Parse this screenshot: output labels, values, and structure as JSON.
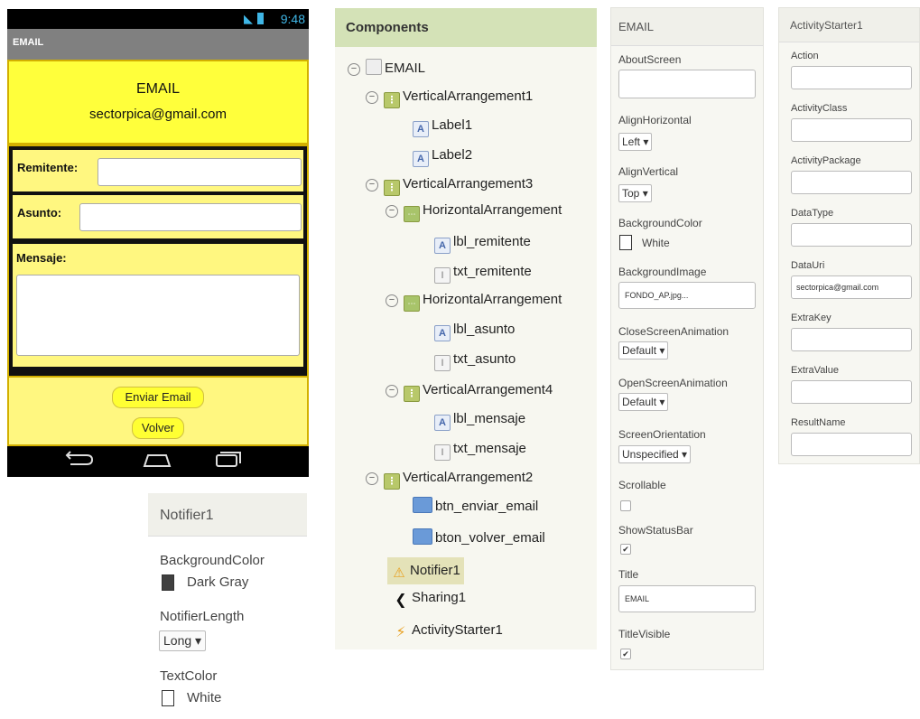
{
  "phone": {
    "status_time": "9:48",
    "title": "EMAIL",
    "header_title": "EMAIL",
    "header_email": "sectorpica@gmail.com",
    "remitente_label": "Remitente:",
    "asunto_label": "Asunto:",
    "mensaje_label": "Mensaje:",
    "send_button": "Enviar Email",
    "back_button": "Volver"
  },
  "notifier": {
    "title": "Notifier1",
    "props": [
      {
        "label": "BackgroundColor",
        "value": "Dark Gray"
      },
      {
        "label": "NotifierLength",
        "value": "Long"
      },
      {
        "label": "TextColor",
        "value": "White"
      }
    ]
  },
  "components": {
    "title": "Components",
    "tree": [
      {
        "label": "EMAIL",
        "icon": "screen-icon"
      },
      {
        "label": "VerticalArrangement1",
        "icon": "vertical-arrangement-icon"
      },
      {
        "label": "Label1",
        "icon": "label-icon"
      },
      {
        "label": "Label2",
        "icon": "label-icon"
      },
      {
        "label": "VerticalArrangement3",
        "icon": "vertical-arrangement-icon"
      },
      {
        "label": "HorizontalArrangement",
        "icon": "horizontal-arrangement-icon"
      },
      {
        "label": "lbl_remitente",
        "icon": "label-icon"
      },
      {
        "label": "txt_remitente",
        "icon": "textbox-icon"
      },
      {
        "label": "HorizontalArrangement",
        "icon": "horizontal-arrangement-icon"
      },
      {
        "label": "lbl_asunto",
        "icon": "label-icon"
      },
      {
        "label": "txt_asunto",
        "icon": "textbox-icon"
      },
      {
        "label": "VerticalArrangement4",
        "icon": "vertical-arrangement-icon"
      },
      {
        "label": "lbl_mensaje",
        "icon": "label-icon"
      },
      {
        "label": "txt_mensaje",
        "icon": "textbox-icon"
      },
      {
        "label": "VerticalArrangement2",
        "icon": "vertical-arrangement-icon"
      },
      {
        "label": "btn_enviar_email",
        "icon": "button-icon"
      },
      {
        "label": "bton_volver_email",
        "icon": "button-icon"
      },
      {
        "label": "Notifier1",
        "icon": "warning-icon"
      },
      {
        "label": "Sharing1",
        "icon": "share-icon"
      },
      {
        "label": "ActivityStarter1",
        "icon": "lightning-icon"
      }
    ]
  },
  "email_props": {
    "title": "EMAIL",
    "about_screen": "AboutScreen",
    "align_horizontal": "AlignHorizontal",
    "align_horizontal_value": "Left",
    "align_vertical": "AlignVertical",
    "align_vertical_value": "Top",
    "background_color": "BackgroundColor",
    "background_color_value": "White",
    "background_image": "BackgroundImage",
    "background_image_value": "FONDO_AP.jpg...",
    "close_anim": "CloseScreenAnimation",
    "close_anim_value": "Default",
    "open_anim": "OpenScreenAnimation",
    "open_anim_value": "Default",
    "orientation": "ScreenOrientation",
    "orientation_value": "Unspecified",
    "scrollable": "Scrollable",
    "show_status_bar": "ShowStatusBar",
    "title_label": "Title",
    "title_value": "EMAIL",
    "title_visible": "TitleVisible"
  },
  "activity_props": {
    "title": "ActivityStarter1",
    "action": "Action",
    "activity_class": "ActivityClass",
    "activity_package": "ActivityPackage",
    "data_type": "DataType",
    "data_uri": "DataUri",
    "data_uri_value": "sectorpica@gmail.com",
    "extra_key": "ExtraKey",
    "extra_value": "ExtraValue",
    "result_name": "ResultName"
  }
}
